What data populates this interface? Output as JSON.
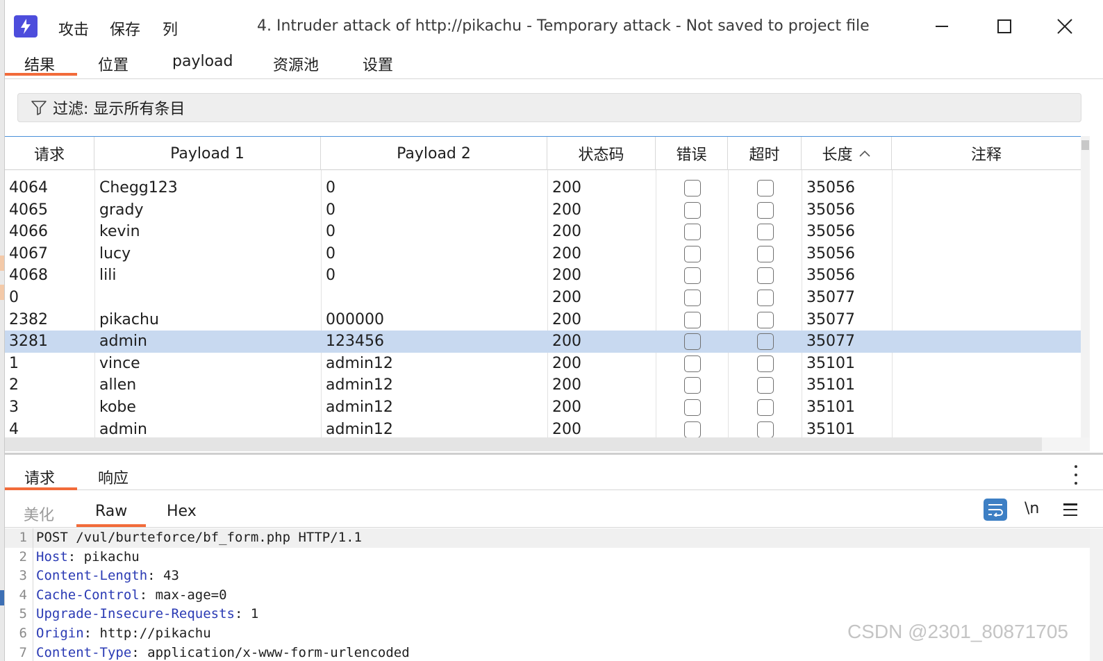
{
  "menu": [
    "攻击",
    "保存",
    "列"
  ],
  "window_title": "4. Intruder attack of http://pikachu - Temporary attack - Not saved to project file",
  "tabs": [
    "结果",
    "位置",
    "payload",
    "资源池",
    "设置"
  ],
  "filter": {
    "label": "过滤: 显示所有条目"
  },
  "table": {
    "columns": [
      "请求",
      "Payload 1",
      "Payload 2",
      "状态码",
      "错误",
      "超时",
      "长度",
      "注释"
    ],
    "rows": [
      {
        "req": "4064",
        "p1": "Chegg123",
        "p2": "0",
        "status": "200",
        "length": "35056"
      },
      {
        "req": "4065",
        "p1": "grady",
        "p2": "0",
        "status": "200",
        "length": "35056"
      },
      {
        "req": "4066",
        "p1": "kevin",
        "p2": "0",
        "status": "200",
        "length": "35056"
      },
      {
        "req": "4067",
        "p1": "lucy",
        "p2": "0",
        "status": "200",
        "length": "35056"
      },
      {
        "req": "4068",
        "p1": "lili",
        "p2": "0",
        "status": "200",
        "length": "35056"
      },
      {
        "req": "0",
        "p1": "",
        "p2": "",
        "status": "200",
        "length": "35077"
      },
      {
        "req": "2382",
        "p1": "pikachu",
        "p2": "000000",
        "status": "200",
        "length": "35077"
      },
      {
        "req": "3281",
        "p1": "admin",
        "p2": "123456",
        "status": "200",
        "length": "35077",
        "selected": true
      },
      {
        "req": "1",
        "p1": "vince",
        "p2": "admin12",
        "status": "200",
        "length": "35101"
      },
      {
        "req": "2",
        "p1": "allen",
        "p2": "admin12",
        "status": "200",
        "length": "35101"
      },
      {
        "req": "3",
        "p1": "kobe",
        "p2": "admin12",
        "status": "200",
        "length": "35101"
      },
      {
        "req": "4",
        "p1": "admin",
        "p2": "admin12",
        "status": "200",
        "length": "35101"
      }
    ]
  },
  "bottom_tabs": [
    "请求",
    "响应"
  ],
  "view_tabs": [
    "美化",
    "Raw",
    "Hex"
  ],
  "newline_toggle": "\\n",
  "editor_lines": [
    {
      "n": "1",
      "text": "POST /vul/burteforce/bf_form.php HTTP/1.1"
    },
    {
      "n": "2",
      "name": "Host",
      "value": ": pikachu"
    },
    {
      "n": "3",
      "name": "Content-Length",
      "value": ": 43"
    },
    {
      "n": "4",
      "name": "Cache-Control",
      "value": ": max-age=0"
    },
    {
      "n": "5",
      "name": "Upgrade-Insecure-Requests",
      "value": ": 1"
    },
    {
      "n": "6",
      "name": "Origin",
      "value": ": http://pikachu"
    },
    {
      "n": "7",
      "name": "Content-Type",
      "value": ": application/x-www-form-urlencoded"
    }
  ],
  "watermark": "CSDN @2301_80871705",
  "colors": {
    "accent": "#f26b3a",
    "selected_row": "#c8d9f0",
    "logo": "#4d4ddc",
    "header_name": "#2a3ab4"
  }
}
